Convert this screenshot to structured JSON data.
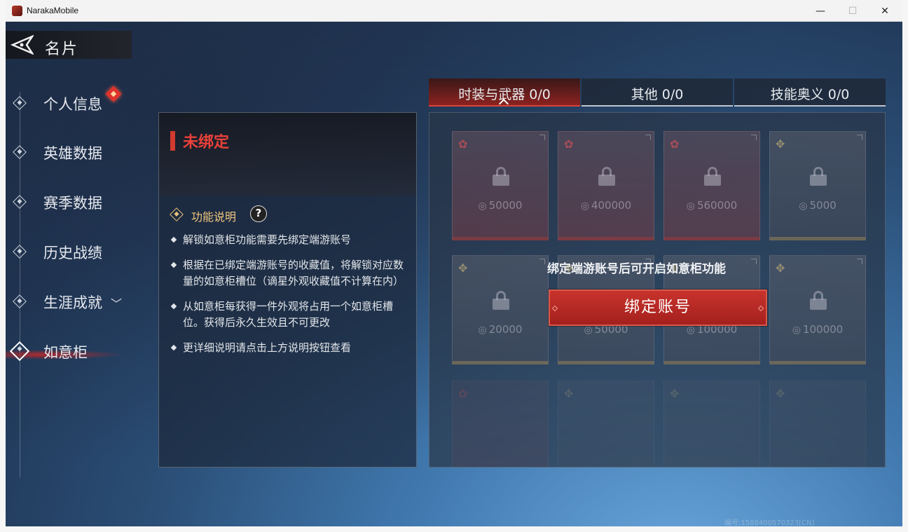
{
  "window": {
    "title": "NarakaMobile",
    "controls": {
      "minimize": "—",
      "maximize": "☐",
      "close": "✕"
    }
  },
  "header": {
    "title": "名片"
  },
  "sidebar": {
    "items": [
      {
        "label": "个人信息"
      },
      {
        "label": "英雄数据"
      },
      {
        "label": "赛季数据"
      },
      {
        "label": "历史战绩"
      },
      {
        "label": "生涯成就",
        "chevron": "﹀"
      },
      {
        "label": "如意柜",
        "active": true
      }
    ]
  },
  "info_panel": {
    "status": "未绑定",
    "section_title": "功能说明",
    "help_button": "?",
    "bullets": [
      "解锁如意柜功能需要先绑定端游账号",
      "根据在已绑定端游账号的收藏值，将解锁对应数量的如意柜槽位（谪星外观收藏值不计算在内）",
      "从如意柜每获得一件外观将占用一个如意柜槽位。获得后永久生效且不可更改",
      "更详细说明请点击上方说明按钮查看"
    ]
  },
  "tabs": [
    {
      "label": "时装与武器  0/0",
      "active": true
    },
    {
      "label": "其他  0/0"
    },
    {
      "label": "技能奥义  0/0"
    }
  ],
  "cabinet": {
    "slots_row1": [
      {
        "price": "50000",
        "rarity": "red"
      },
      {
        "price": "400000",
        "rarity": "red"
      },
      {
        "price": "560000",
        "rarity": "red"
      },
      {
        "price": "5000",
        "rarity": "gold"
      }
    ],
    "slots_row2": [
      {
        "price": "20000",
        "rarity": "gold"
      },
      {
        "price": "50000",
        "rarity": "gold"
      },
      {
        "price": "100000",
        "rarity": "gold"
      },
      {
        "price": "100000",
        "rarity": "gold"
      }
    ],
    "bind_message": "绑定端游账号后可开启如意柜功能",
    "bind_button": "绑定账号"
  },
  "watermark": "编号:1588400570323[CN]",
  "colors": {
    "accent_red": "#c8332c",
    "gold": "#f0c77e",
    "active_tab": "#8c2220"
  }
}
